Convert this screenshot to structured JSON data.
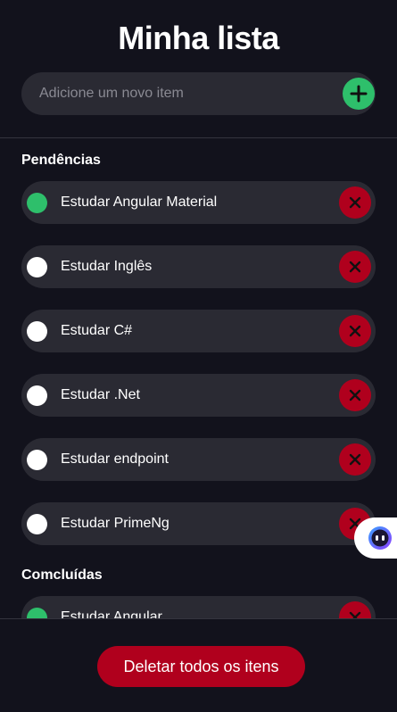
{
  "app": {
    "title": "Minha lista"
  },
  "add": {
    "placeholder": "Adicione um novo item"
  },
  "pending": {
    "title": "Pendências",
    "items": [
      {
        "label": "Estudar Angular Material",
        "done": true
      },
      {
        "label": "Estudar Inglês",
        "done": false
      },
      {
        "label": "Estudar C#",
        "done": false
      },
      {
        "label": "Estudar .Net",
        "done": false
      },
      {
        "label": "Estudar endpoint",
        "done": false
      },
      {
        "label": "Estudar PrimeNg",
        "done": false
      }
    ]
  },
  "completed": {
    "title": "Comcluídas",
    "items": [
      {
        "label": "Estudar Angular",
        "done": true
      }
    ]
  },
  "footer": {
    "delete_all_label": "Deletar todos os itens"
  },
  "colors": {
    "background": "#12121c",
    "surface": "#2a2a33",
    "green": "#2ebf6b",
    "red": "#b0001d"
  },
  "icons": {
    "add": "plus-icon",
    "delete": "x-icon",
    "widget": "chat-bot-icon"
  }
}
